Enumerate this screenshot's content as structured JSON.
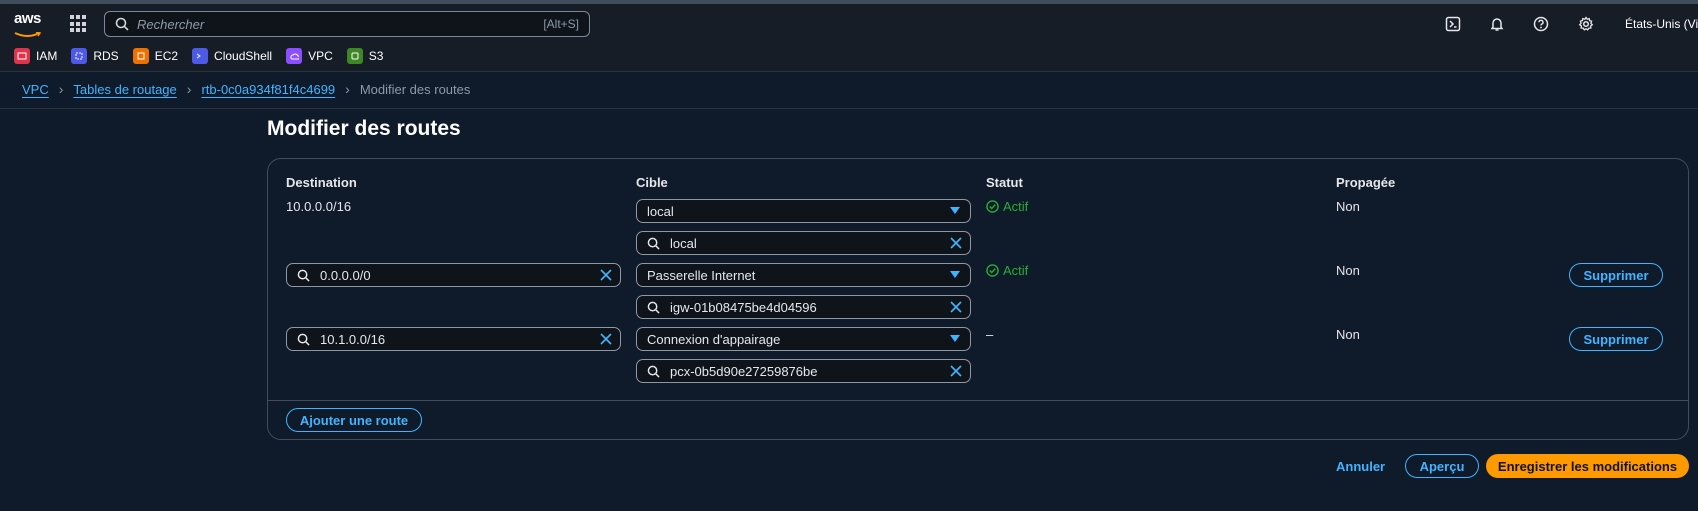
{
  "topbar": {
    "logo_text": "aws",
    "search_placeholder": "Rechercher",
    "search_shortcut": "[Alt+S]",
    "region": "États-Unis (Virg"
  },
  "favorites": [
    {
      "label": "IAM",
      "color": "#dd344c"
    },
    {
      "label": "RDS",
      "color": "#4d5ae8"
    },
    {
      "label": "EC2",
      "color": "#ed7100"
    },
    {
      "label": "CloudShell",
      "color": "#4d5ae8"
    },
    {
      "label": "VPC",
      "color": "#8c4fff"
    },
    {
      "label": "S3",
      "color": "#3f8624"
    }
  ],
  "breadcrumb": {
    "vpc": "VPC",
    "tables": "Tables de routage",
    "rtb": "rtb-0c0a934f81f4c4699",
    "current": "Modifier des routes"
  },
  "page_title": "Modifier des routes",
  "table": {
    "headers": {
      "destination": "Destination",
      "target": "Cible",
      "status": "Statut",
      "propagated": "Propagée"
    },
    "rows": [
      {
        "destination": "10.0.0.0/16",
        "target_type": "local",
        "target_value": "local",
        "status": "Actif",
        "propagated": "Non"
      },
      {
        "destination": "0.0.0.0/0",
        "target_type": "Passerelle Internet",
        "target_value": "igw-01b08475be4d04596",
        "status": "Actif",
        "propagated": "Non",
        "remove": "Supprimer"
      },
      {
        "destination": "10.1.0.0/16",
        "target_type": "Connexion d'appairage",
        "target_value": "pcx-0b5d90e27259876be",
        "status": "–",
        "propagated": "Non",
        "remove": "Supprimer"
      }
    ],
    "add_route": "Ajouter une route"
  },
  "footer": {
    "cancel": "Annuler",
    "preview": "Aperçu",
    "save": "Enregistrer les modifications"
  },
  "colors": {
    "link": "#42b4ff",
    "success": "#29ad32",
    "primary": "#ff9900"
  }
}
